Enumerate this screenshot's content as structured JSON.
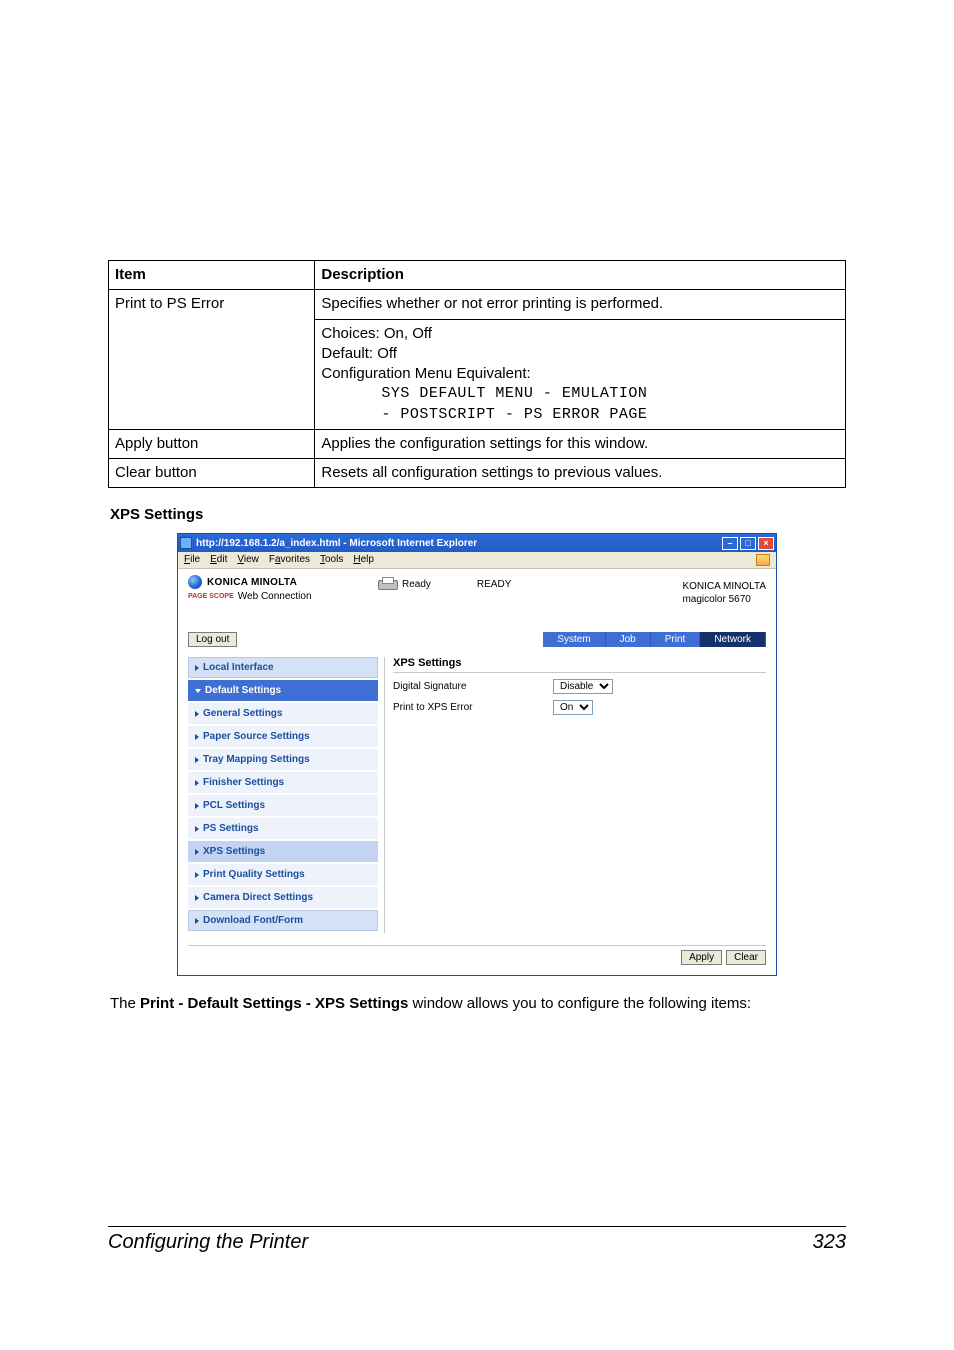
{
  "table": {
    "head_item": "Item",
    "head_desc": "Description",
    "row1_item": "Print to PS Error",
    "row1_desc_line1": "Specifies whether or not error printing is performed.",
    "row1_desc_line2": "Choices: On, Off",
    "row1_desc_line3": "Default:  Off",
    "row1_desc_line4": "Configuration Menu Equivalent:",
    "row1_desc_line5": "SYS DEFAULT MENU - EMULATION",
    "row1_desc_line6": "- POSTSCRIPT - PS ERROR PAGE",
    "row2_item": "Apply button",
    "row2_desc": "Applies the configuration settings for this window.",
    "row3_item": "Clear button",
    "row3_desc": "Resets all configuration settings to previous values."
  },
  "section_heading": "XPS Settings",
  "ie": {
    "title": "http://192.168.1.2/a_index.html - Microsoft Internet Explorer",
    "menus": {
      "file": "File",
      "edit": "Edit",
      "view": "View",
      "favorites": "Favorites",
      "tools": "Tools",
      "help": "Help"
    },
    "brand1": "KONICA MINOLTA",
    "ps_badge": "PAGE SCOPE",
    "brand2": "Web Connection",
    "ready": "Ready",
    "ready_caps": "READY",
    "right_line1": "KONICA MINOLTA",
    "right_line2": "magicolor 5670",
    "logout": "Log out",
    "tabs": {
      "system": "System",
      "job": "Job",
      "print": "Print",
      "network": "Network"
    },
    "sidebar": {
      "local_interface": "Local Interface",
      "default_settings": "Default Settings",
      "general": "General Settings",
      "paper_source": "Paper Source Settings",
      "tray_mapping": "Tray Mapping Settings",
      "finisher": "Finisher Settings",
      "pcl": "PCL Settings",
      "ps": "PS Settings",
      "xps": "XPS Settings",
      "print_quality": "Print Quality Settings",
      "camera": "Camera Direct Settings",
      "download": "Download Font/Form"
    },
    "pane": {
      "heading": "XPS Settings",
      "digital_sig_label": "Digital Signature",
      "digital_sig_value": "Disable",
      "print_xps_label": "Print to XPS Error",
      "print_xps_value": "On"
    },
    "footer_apply": "Apply",
    "footer_clear": "Clear"
  },
  "body_para_pre": "The ",
  "body_para_bold": "Print - Default Settings - XPS Settings",
  "body_para_post": " window allows you to configure the following items:",
  "footer_title": "Configuring the Printer",
  "footer_page": "323"
}
